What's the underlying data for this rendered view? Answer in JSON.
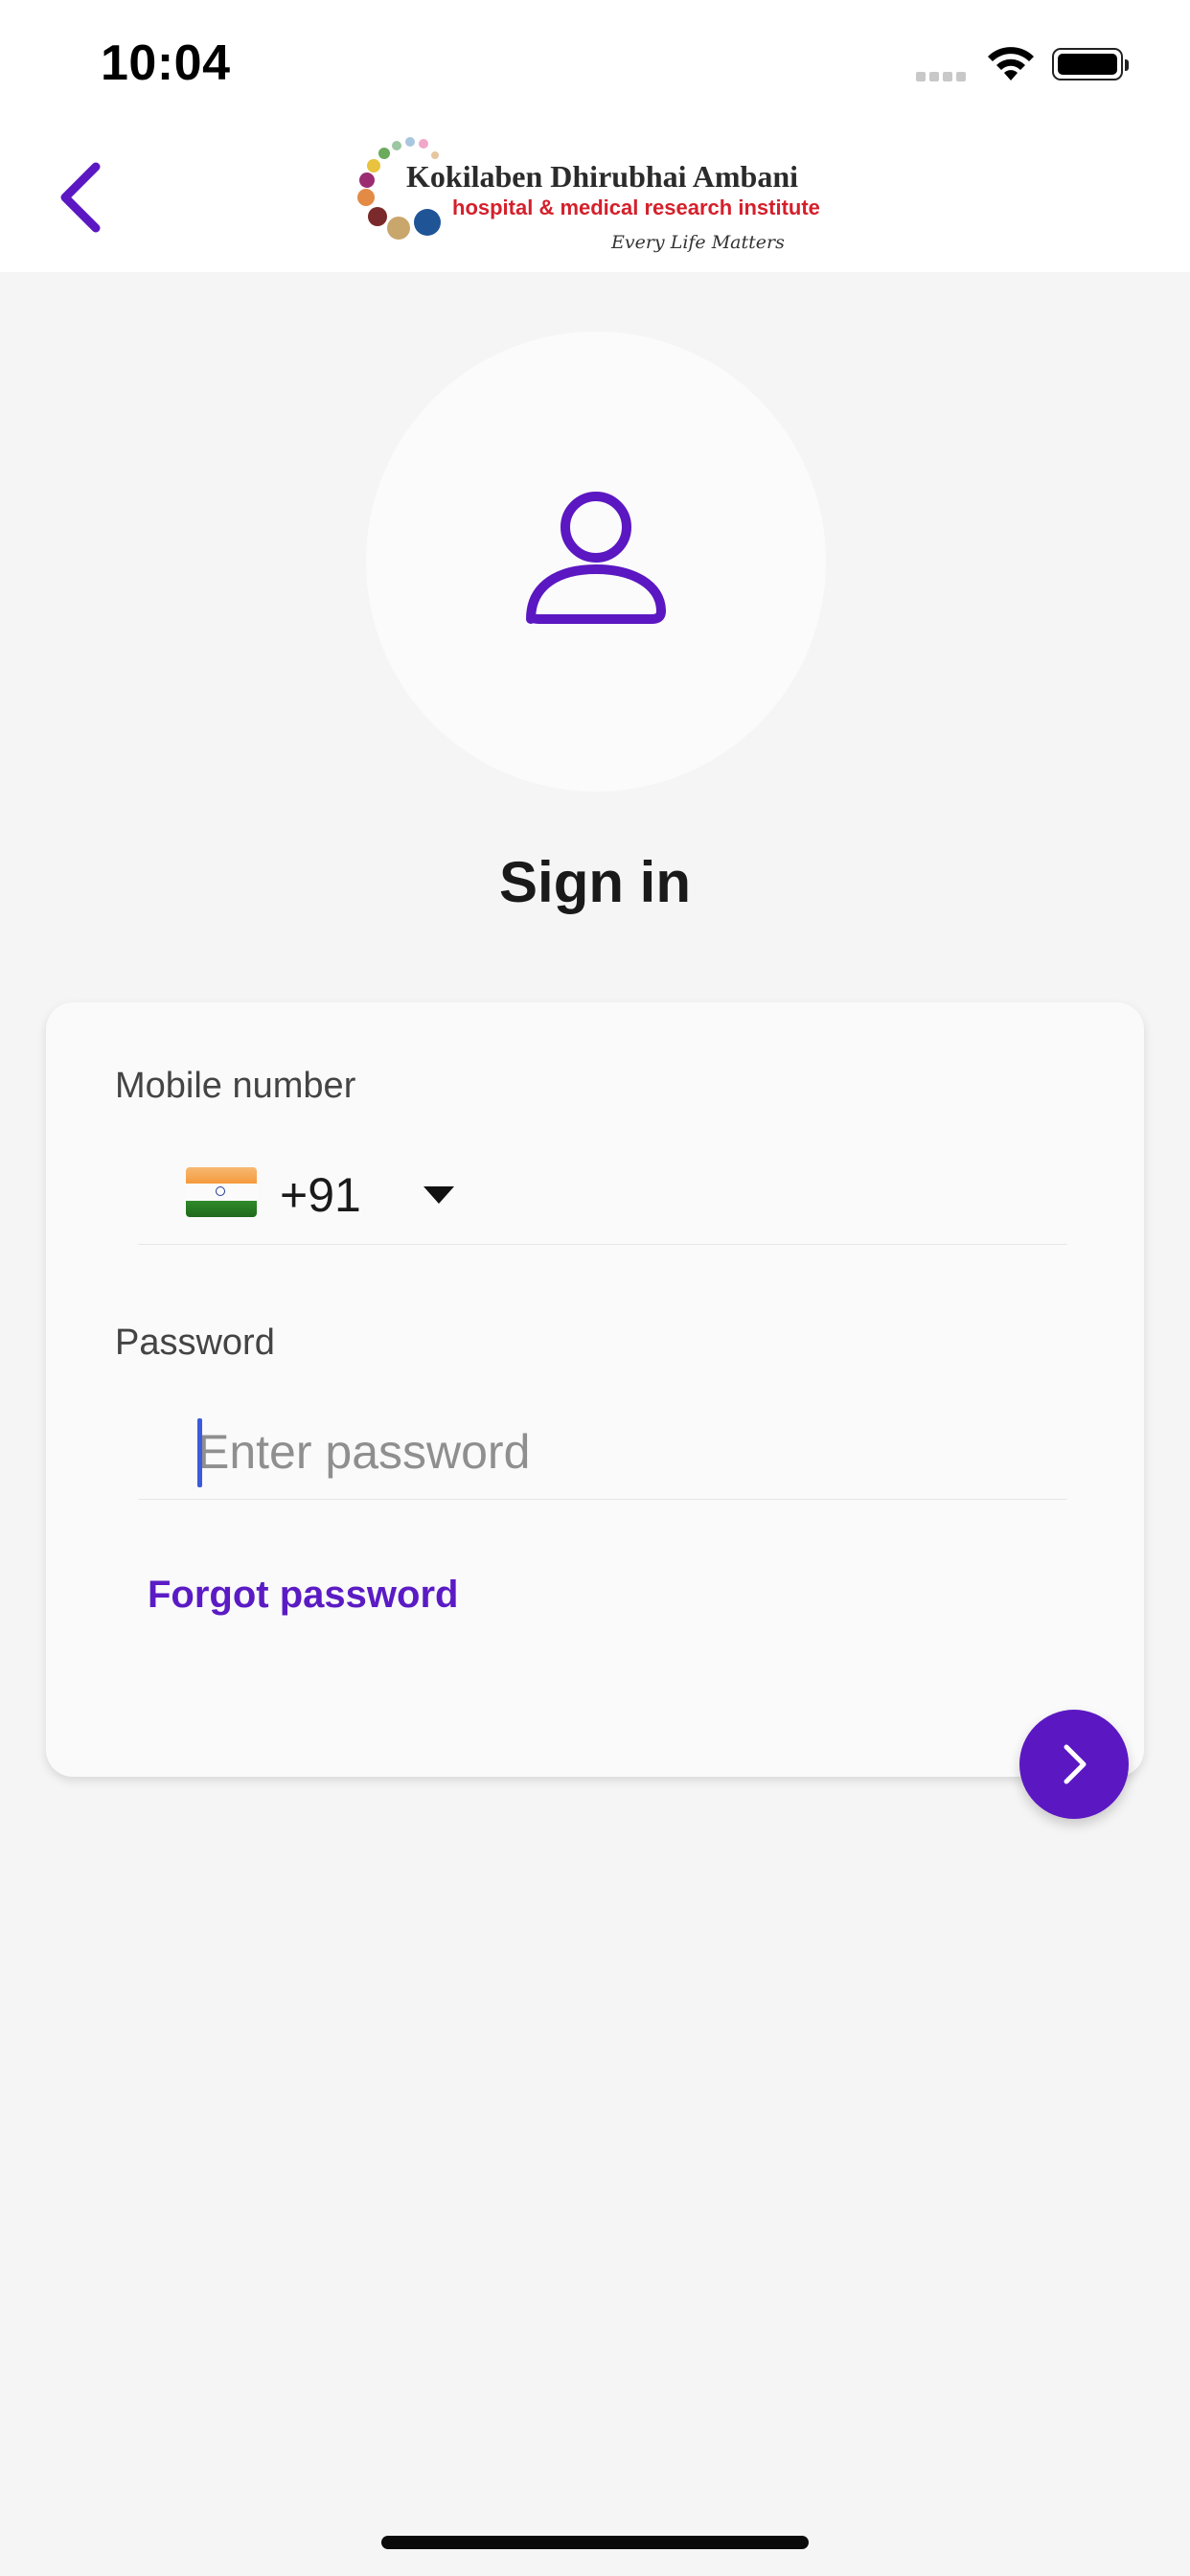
{
  "status_bar": {
    "time": "10:04",
    "icons": [
      "cellular-signal-icon",
      "wifi-icon",
      "battery-icon"
    ]
  },
  "nav": {
    "back_icon": "chevron-left-icon",
    "logo": {
      "title": "Kokilaben Dhirubhai Ambani",
      "subtitle": "hospital & medical research institute",
      "tagline": "Every Life Matters"
    }
  },
  "avatar": {
    "icon": "person-icon"
  },
  "page": {
    "title": "Sign in"
  },
  "form": {
    "mobile_label": "Mobile number",
    "country_flag": "india-flag-icon",
    "country_code": "+91",
    "password_label": "Password",
    "password_placeholder": "Enter password",
    "password_value": "",
    "forgot_label": "Forgot password",
    "submit_icon": "chevron-right-icon"
  },
  "colors": {
    "accent": "#5b17c2",
    "background": "#f5f5f5",
    "card": "#fafafa",
    "logo_red": "#d4202b"
  }
}
